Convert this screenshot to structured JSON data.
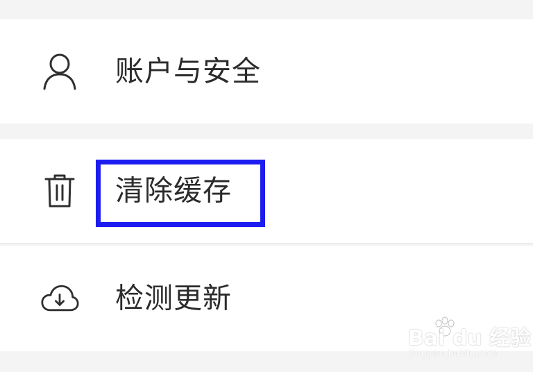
{
  "settings": {
    "items": [
      {
        "icon": "user-icon",
        "label": "账户与安全"
      },
      {
        "icon": "trash-icon",
        "label": "清除缓存"
      },
      {
        "icon": "cloud-download-icon",
        "label": "检测更新"
      }
    ]
  },
  "highlight": {
    "target": "清除缓存",
    "color": "#1c1cf0"
  },
  "watermark": {
    "brand": "Bai du 经验",
    "site": "jingyan.baidu.com"
  }
}
